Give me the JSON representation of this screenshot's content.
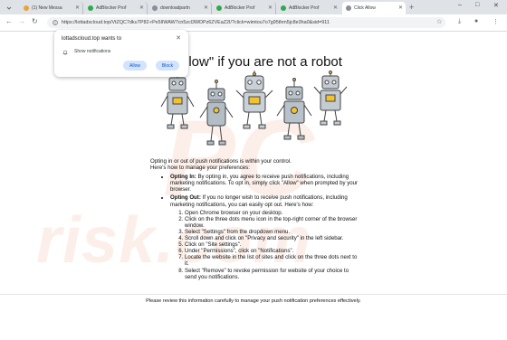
{
  "tabs": [
    {
      "label": "(1) New Messa",
      "icon": "messages-icon",
      "color": "#e8a33d"
    },
    {
      "label": "AdBlocker Prof",
      "icon": "green-check-icon",
      "color": "#2eaa4a"
    },
    {
      "label": "downloadpartn",
      "icon": "globe-icon",
      "color": "#8a8f95"
    },
    {
      "label": "AdBlocker Prof",
      "icon": "green-check-icon",
      "color": "#2eaa4a"
    },
    {
      "label": "AdBlocker Prof",
      "icon": "green-check-icon",
      "color": "#2eaa4a"
    },
    {
      "label": "Click Allow",
      "icon": "globe-icon",
      "color": "#8a8f95",
      "active": true
    }
  ],
  "window": {
    "minimize": "–",
    "maximize": "□",
    "close": "✕"
  },
  "omnibox": {
    "url": "https://lottadscloud.top/VtZQC7dkuTP82-rPe5lIWAW7cn5zcl3WDPz6ZVEaZ2I/?click=wimtou7o7g95thm5jc8e3ha0&sid=911"
  },
  "popup": {
    "title": "lottadscloud.top wants to",
    "permission": "Show notifications",
    "allow": "Allow",
    "block": "Block"
  },
  "page": {
    "headline": "Allow\" if you are not a robot",
    "intro1": "Opting in or out of push notifications is within your control.",
    "intro2": "Here's how to manage your preferences:",
    "opt_in_label": "Opting In:",
    "opt_in_text": " By opting in, you agree to receive push notifications, including marketing notifications. To opt in, simply click \"Allow\" when prompted by your browser.",
    "opt_out_label": "Opting Out:",
    "opt_out_text": " If you no longer wish to receive push notifications, including marketing notifications, you can easily opt out. Here's how:",
    "steps": [
      "Open Chrome browser on your desktop.",
      "Click on the three dots menu icon in the top-right corner of the browser window.",
      "Select \"Settings\" from the dropdown menu.",
      "Scroll down and click on \"Privacy and security\" in the left sidebar.",
      "Click on \"Site settings\".",
      "Under \"Permissions\", click on \"Notifications\".",
      "Locate the website in the list of sites and click on the three dots next to it.",
      "Select \"Remove\" to revoke permission for website of your choice to send you notifications."
    ],
    "footer": "Please review this information carefully to manage your push notification preferences effectively."
  }
}
